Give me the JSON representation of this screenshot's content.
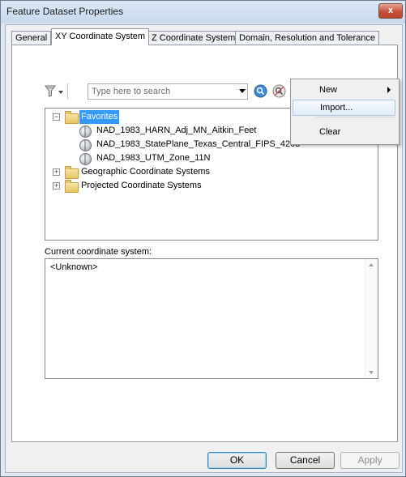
{
  "window": {
    "title": "Feature Dataset Properties",
    "close_glyph": "x"
  },
  "tabs": [
    {
      "label": "General"
    },
    {
      "label": "XY Coordinate System"
    },
    {
      "label": "Z Coordinate System"
    },
    {
      "label": "Domain, Resolution and Tolerance"
    }
  ],
  "toolbar": {
    "search_placeholder": "Type here to search",
    "icons": [
      "filter-icon",
      "dropdown-icon",
      "search-icon",
      "clear-search-icon",
      "globe-icon",
      "add-favorite-icon"
    ]
  },
  "tree": {
    "favorites": {
      "label": "Favorites",
      "expander": "−",
      "children": [
        "NAD_1983_HARN_Adj_MN_Aitkin_Feet",
        "NAD_1983_StatePlane_Texas_Central_FIPS_4203",
        "NAD_1983_UTM_Zone_11N"
      ]
    },
    "geographic": {
      "label": "Geographic Coordinate Systems",
      "expander": "+"
    },
    "projected": {
      "label": "Projected Coordinate Systems",
      "expander": "+"
    }
  },
  "current": {
    "label": "Current coordinate system:",
    "value": "<Unknown>"
  },
  "menu": {
    "new": "New",
    "import": "Import...",
    "clear": "Clear"
  },
  "buttons": {
    "ok": "OK",
    "cancel": "Cancel",
    "apply": "Apply"
  },
  "colors": {
    "selection": "#3399ff",
    "title_bar": "#dbe7f5",
    "close": "#c9503a"
  }
}
